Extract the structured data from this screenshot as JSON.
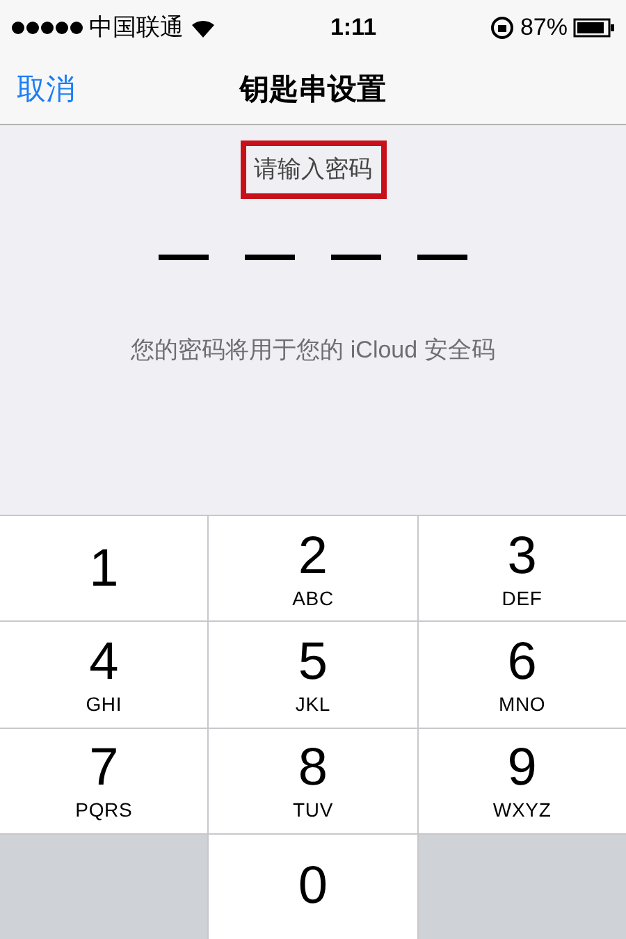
{
  "status_bar": {
    "carrier": "中国联通",
    "time": "1:11",
    "battery": "87%"
  },
  "nav": {
    "cancel": "取消",
    "title": "钥匙串设置"
  },
  "prompt": {
    "text": "请输入密码",
    "highlighted": true
  },
  "pin_slots": [
    {
      "filled": false
    },
    {
      "filled": false
    },
    {
      "filled": false
    },
    {
      "filled": false
    }
  ],
  "hint": "您的密码将用于您的 iCloud 安全码",
  "keys": [
    {
      "kind": "digit",
      "digit": "1"
    },
    {
      "kind": "digit",
      "digit": "2",
      "letters": "ABC"
    },
    {
      "kind": "digit",
      "digit": "3",
      "letters": "DEF"
    },
    {
      "kind": "digit",
      "digit": "4",
      "letters": "GHI"
    },
    {
      "kind": "digit",
      "digit": "5",
      "letters": "JKL"
    },
    {
      "kind": "digit",
      "digit": "6",
      "letters": "MNO"
    },
    {
      "kind": "digit",
      "digit": "7",
      "letters": "PQRS"
    },
    {
      "kind": "digit",
      "digit": "8",
      "letters": "TUV"
    },
    {
      "kind": "digit",
      "digit": "9",
      "letters": "WXYZ"
    },
    {
      "kind": "blank"
    },
    {
      "kind": "digit",
      "digit": "0"
    },
    {
      "kind": "blank"
    }
  ]
}
